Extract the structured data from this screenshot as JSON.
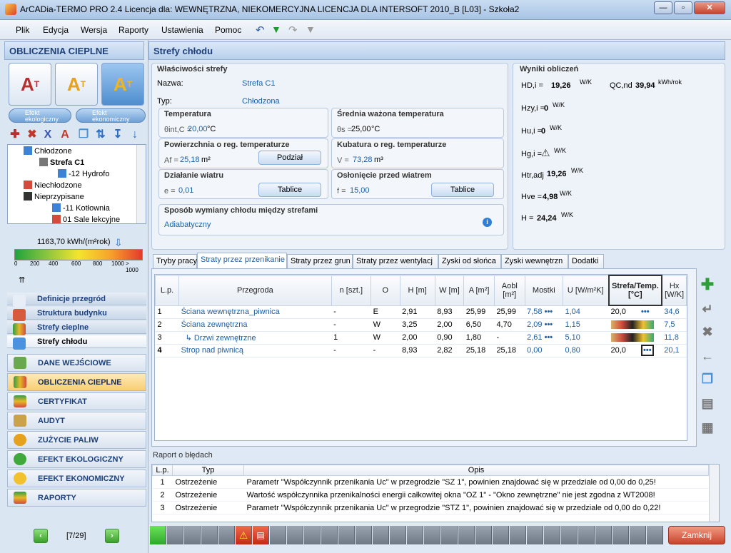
{
  "window": {
    "title": "ArCADia-TERMO PRO 2.4 Licencja dla: WEWNĘTRZNA, NIEKOMERCYJNA LICENCJA DLA INTERSOFT 2010_B [L03] - Szkoła2"
  },
  "menu": [
    "Plik",
    "Edycja",
    "Wersja",
    "Raporty",
    "Ustawienia",
    "Pomoc"
  ],
  "left": {
    "header": "OBLICZENIA CIEPLNE",
    "pill1": "Efekt ekologiczny",
    "pill2": "Efekt ekonomiczny",
    "tree": [
      {
        "label": "Chłodzone",
        "bold": false
      },
      {
        "label": "Strefa C1",
        "bold": true
      },
      {
        "label": "-12 Hydrofo",
        "bold": false
      },
      {
        "label": "Niechłodzone",
        "bold": false
      },
      {
        "label": "Nieprzypisane",
        "bold": false
      },
      {
        "label": "-11 Kotłownia",
        "bold": false
      },
      {
        "label": "01 Sale lekcyjne",
        "bold": false
      }
    ],
    "energy_value": "1163,70 kWh/(m²rok)",
    "scale": [
      "0",
      "200",
      "400",
      "600",
      "800",
      "1000",
      "> 1000"
    ],
    "subnav": [
      "Definicje przegród",
      "Struktura budynku",
      "Strefy cieplne",
      "Strefy chłodu"
    ],
    "nav": [
      "DANE WEJŚCIOWE",
      "OBLICZENIA CIEPLNE",
      "CERTYFIKAT",
      "AUDYT",
      "ZUŻYCIE PALIW",
      "EFEKT EKOLOGICZNY",
      "EFEKT EKONOMICZNY",
      "RAPORTY"
    ],
    "page": "[7/29]"
  },
  "main": {
    "header": "Strefy chłodu",
    "props_title": "Właściwości strefy",
    "name_label": "Nazwa:",
    "name_value": "Strefa C1",
    "type_label": "Typ:",
    "type_value": "Chłodzona",
    "temp_title": "Temperatura",
    "temp_sym": "θint,C =",
    "temp_value": "20,00",
    "temp_unit": "°C",
    "avg_title": "Średnia ważona temperatura",
    "avg_sym": "θs =",
    "avg_value": "25,00",
    "avg_unit": "°C",
    "area_title": "Powierzchnia o reg. temperaturze",
    "area_sym": "Af =",
    "area_value": "25,18",
    "area_unit": "m²",
    "area_btn": "Podział",
    "vol_title": "Kubatura o reg. temperaturze",
    "vol_sym": "V =",
    "vol_value": "73,28",
    "vol_unit": "m³",
    "wind_title": "Działanie wiatru",
    "wind_sym": "e =",
    "wind_value": "0,01",
    "wind_btn": "Tablice",
    "shield_title": "Osłonięcie przed wiatrem",
    "shield_sym": "f =",
    "shield_value": "15,00",
    "shield_btn": "Tablice",
    "exchange_title": "Sposób wymiany chłodu między strefami",
    "exchange_value": "Adiabatyczny",
    "results_title": "Wyniki obliczeń",
    "results": [
      {
        "sym": "HD,i =",
        "val": "19,26",
        "unit": "W/K"
      },
      {
        "sym": "Hzy,i =",
        "val": "0",
        "unit": "W/K"
      },
      {
        "sym": "Hu,i =",
        "val": "0",
        "unit": "W/K"
      },
      {
        "sym": "Hg,i =",
        "val": "",
        "unit": "W/K"
      },
      {
        "sym": "Htr,adj",
        "val": "19,26",
        "unit": "W/K"
      },
      {
        "sym": "Hve =",
        "val": "4,98",
        "unit": "W/K"
      },
      {
        "sym": "H =",
        "val": "24,24",
        "unit": "W/K"
      }
    ],
    "qc": {
      "sym": "QC,nd",
      "val": "39,94",
      "unit": "kWh/rok"
    },
    "tabs": [
      "Tryby pracy",
      "Straty przez przenikanie",
      "Straty przez grun",
      "Straty przez wentylacj",
      "Zyski od słońca",
      "Zyski wewnętrzn",
      "Dodatki"
    ],
    "columns": [
      "L.p.",
      "Przegroda",
      "n [szt.]",
      "O",
      "H [m]",
      "W [m]",
      "A [m²]",
      "Aobl [m²]",
      "Mostki",
      "U [W/m²K]",
      "Strefa/Temp. [°C]",
      "Hx [W/K]"
    ],
    "rows": [
      [
        "1",
        "Ściana wewnętrzna_piwnica",
        "-",
        "E",
        "2,91",
        "8,93",
        "25,99",
        "25,99",
        "7,58",
        "1,04",
        "20,0",
        "34,6"
      ],
      [
        "2",
        "Ściana zewnętrzna",
        "-",
        "W",
        "3,25",
        "2,00",
        "6,50",
        "4,70",
        "2,09",
        "1,15",
        "",
        "7,5"
      ],
      [
        "3",
        "Drzwi zewnętrzne",
        "1",
        "W",
        "2,00",
        "0,90",
        "1,80",
        "-",
        "2,61",
        "5,10",
        "",
        "11,8"
      ],
      [
        "4",
        "Strop nad piwnicą",
        "-",
        "-",
        "8,93",
        "2,82",
        "25,18",
        "25,18",
        "0,00",
        "0,80",
        "20,0",
        "20,1"
      ]
    ],
    "report_title": "Raport o błędach",
    "report_cols": [
      "L.p.",
      "Typ",
      "Opis"
    ],
    "report": [
      [
        "1",
        "Ostrzeżenie",
        "Parametr \"Współczynnik przenikania Uc\" w przegrodzie \"SZ 1\", powinien znajdować się w przedziale od 0,00 do 0,25!"
      ],
      [
        "2",
        "Ostrzeżenie",
        "Wartość współczynnika przenikalności energii całkowitej okna \"OZ 1\" - \"Okno zewnętrzne\" nie jest zgodna z WT2008!"
      ],
      [
        "3",
        "Ostrzeżenie",
        "Parametr \"Współczynnik przenikania Uc\" w przegrodzie \"STZ 1\", powinien znajdować się w przedziale od 0,00 do 0,22!"
      ]
    ],
    "close": "Zamknij"
  }
}
